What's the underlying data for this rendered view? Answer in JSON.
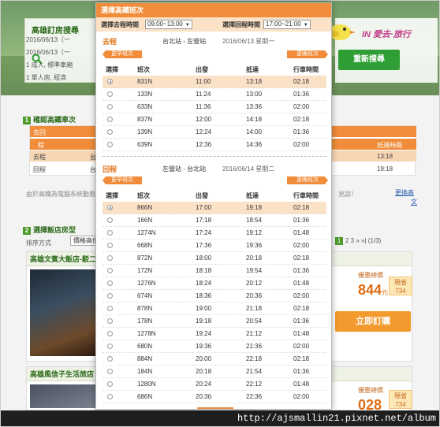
{
  "background": {
    "search_title": "高雄訂房搜尋",
    "search_lines": [
      "2016/06/13（一",
      "2016/06/13（一",
      "1 成人, 標準車廂",
      "1 單人房, 經濟"
    ],
    "logo_text": "IN 愛去·旅行",
    "research_button": "重新搜尋",
    "step1_num": "1",
    "step1_label": "確認高鐵車次",
    "table_header_1": "去回",
    "table_header_2": "程",
    "table_row_go": "去程",
    "table_row_go_sub": "台",
    "table_row_back": "回程",
    "table_row_back_sub": "台",
    "table_arrive_label": "抵達時間",
    "table_go_arrive": "13:18",
    "table_back_arrive": "19:18",
    "note_text": "由於高鐵為電腦系統動態...",
    "note_tail": "見諒！",
    "link_change": "更換高",
    "link_change_2": "文",
    "step2_num": "2",
    "step2_label": "選擇飯店房型",
    "sort_label": "排序方式",
    "sort_value": "價格高低",
    "pager_current": "1",
    "pager_rest": "2  3  »  »|  (1/3)",
    "hotel1_title": "高雄文賓大飯店-駁二",
    "hotel1_price_label": "優惠總價",
    "hotel1_price": "844",
    "hotel1_unit": "元",
    "hotel1_discount": "現省",
    "hotel1_discount_val": "734",
    "book_button": "立即訂購",
    "hotel2_title": "高雄風信子生活旅店",
    "hotel2_price_label": "優惠總價",
    "hotel2_price": "028",
    "hotel2_discount": "現省",
    "hotel2_discount_val": "734",
    "watermark": "http://ajsmallin21.pixnet.net/album"
  },
  "modal": {
    "title": "選擇高鐵班次",
    "depart_time_label": "選擇去程時間",
    "depart_time_value": "09:00~13:00",
    "return_time_label": "選擇回程時間",
    "return_time_value": "17:00~21:00",
    "outbound": {
      "label": "去程",
      "route": "台北站 - 左營站",
      "date": "2016/06/13 星期一",
      "prev_label": "更早班次",
      "next_label": "更晚班次",
      "headers": [
        "選擇",
        "班次",
        "出發",
        "抵達",
        "行車時間"
      ],
      "rows": [
        {
          "train": "831N",
          "dep": "11:00",
          "arr": "13:18",
          "dur": "02:18",
          "selected": true
        },
        {
          "train": "133N",
          "dep": "11:24",
          "arr": "13:00",
          "dur": "01:36",
          "selected": false
        },
        {
          "train": "633N",
          "dep": "11:36",
          "arr": "13:36",
          "dur": "02:00",
          "selected": false
        },
        {
          "train": "837N",
          "dep": "12:00",
          "arr": "14:18",
          "dur": "02:18",
          "selected": false
        },
        {
          "train": "139N",
          "dep": "12:24",
          "arr": "14:00",
          "dur": "01:36",
          "selected": false
        },
        {
          "train": "639N",
          "dep": "12:36",
          "arr": "14:36",
          "dur": "02:00",
          "selected": false
        }
      ]
    },
    "inbound": {
      "label": "回程",
      "route": "左營站 - 台北站",
      "date": "2016/06/14 星期二",
      "prev_label": "更早班次",
      "next_label": "更晚班次",
      "headers": [
        "選擇",
        "班次",
        "出發",
        "抵達",
        "行車時間"
      ],
      "rows": [
        {
          "train": "866N",
          "dep": "17:00",
          "arr": "19:18",
          "dur": "02:18",
          "selected": true
        },
        {
          "train": "166N",
          "dep": "17:18",
          "arr": "18:54",
          "dur": "01:36",
          "selected": false
        },
        {
          "train": "1274N",
          "dep": "17:24",
          "arr": "19:12",
          "dur": "01:48",
          "selected": false
        },
        {
          "train": "668N",
          "dep": "17:36",
          "arr": "19:36",
          "dur": "02:00",
          "selected": false
        },
        {
          "train": "872N",
          "dep": "18:00",
          "arr": "20:18",
          "dur": "02:18",
          "selected": false
        },
        {
          "train": "172N",
          "dep": "18:18",
          "arr": "19:54",
          "dur": "01:36",
          "selected": false
        },
        {
          "train": "1276N",
          "dep": "18:24",
          "arr": "20:12",
          "dur": "01:48",
          "selected": false
        },
        {
          "train": "674N",
          "dep": "18:36",
          "arr": "20:36",
          "dur": "02:00",
          "selected": false
        },
        {
          "train": "878N",
          "dep": "19:00",
          "arr": "21:18",
          "dur": "02:18",
          "selected": false
        },
        {
          "train": "178N",
          "dep": "19:18",
          "arr": "20:54",
          "dur": "01:36",
          "selected": false
        },
        {
          "train": "1278N",
          "dep": "19:24",
          "arr": "21:12",
          "dur": "01:48",
          "selected": false
        },
        {
          "train": "680N",
          "dep": "19:36",
          "arr": "21:36",
          "dur": "02:00",
          "selected": false
        },
        {
          "train": "884N",
          "dep": "20:00",
          "arr": "22:18",
          "dur": "02:18",
          "selected": false
        },
        {
          "train": "184N",
          "dep": "20:18",
          "arr": "21:54",
          "dur": "01:36",
          "selected": false
        },
        {
          "train": "1280N",
          "dep": "20:24",
          "arr": "22:12",
          "dur": "01:48",
          "selected": false
        },
        {
          "train": "686N",
          "dep": "20:36",
          "arr": "22:36",
          "dur": "02:00",
          "selected": false
        }
      ]
    }
  },
  "colors": {
    "accent_orange": "#f08c3a",
    "selected_row": "#fbe2c7",
    "green_button": "#2f9e35"
  }
}
